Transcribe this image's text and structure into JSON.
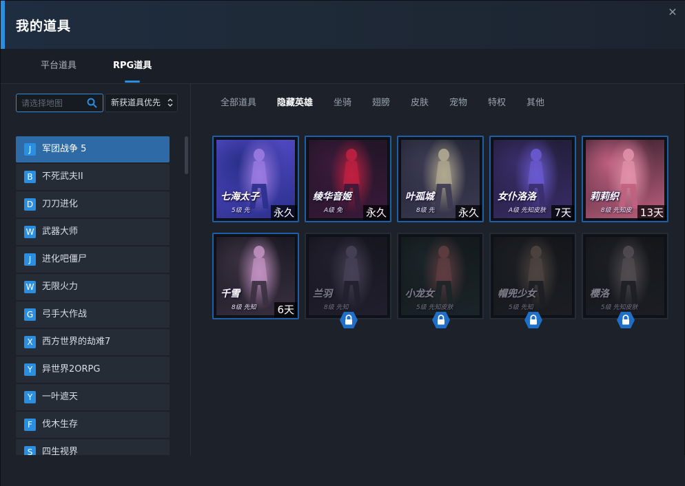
{
  "window": {
    "title": "我的道具"
  },
  "top_tabs": [
    {
      "label": "平台道具",
      "active": false
    },
    {
      "label": "RPG道具",
      "active": true
    }
  ],
  "sidebar": {
    "search_placeholder": "请选择地图",
    "sort_value": "新获道具优先",
    "games": [
      {
        "letter": "J",
        "name": "军团战争 5",
        "active": true
      },
      {
        "letter": "B",
        "name": "不死武夫II",
        "active": false
      },
      {
        "letter": "D",
        "name": "刀刀进化",
        "active": false
      },
      {
        "letter": "W",
        "name": "武器大师",
        "active": false
      },
      {
        "letter": "J",
        "name": "进化吧僵尸",
        "active": false
      },
      {
        "letter": "W",
        "name": "无限火力",
        "active": false
      },
      {
        "letter": "G",
        "name": "弓手大作战",
        "active": false
      },
      {
        "letter": "X",
        "name": "西方世界的劫难7",
        "active": false
      },
      {
        "letter": "Y",
        "name": "异世界2ORPG",
        "active": false
      },
      {
        "letter": "Y",
        "name": "一叶遮天",
        "active": false
      },
      {
        "letter": "F",
        "name": "伐木生存",
        "active": false
      },
      {
        "letter": "S",
        "name": "四生视界",
        "active": false
      }
    ]
  },
  "category_tabs": [
    {
      "label": "全部道具",
      "active": false
    },
    {
      "label": "隐藏英雄",
      "active": true
    },
    {
      "label": "坐骑",
      "active": false
    },
    {
      "label": "翅膀",
      "active": false
    },
    {
      "label": "皮肤",
      "active": false
    },
    {
      "label": "宠物",
      "active": false
    },
    {
      "label": "特权",
      "active": false
    },
    {
      "label": "其他",
      "active": false
    }
  ],
  "items": [
    {
      "caption": "七海太子",
      "sub": "5级 先",
      "duration": "永久",
      "locked": false,
      "palette": [
        "#5a4fd0",
        "#2a2f8a",
        "#9a7be0"
      ]
    },
    {
      "caption": "绫华音姬",
      "sub": "A级 免",
      "duration": "永久",
      "locked": false,
      "palette": [
        "#1a1420",
        "#3a1a3a",
        "#c02040"
      ]
    },
    {
      "caption": "叶孤城",
      "sub": "8级 先",
      "duration": "永久",
      "locked": false,
      "palette": [
        "#1e2230",
        "#3c3a52",
        "#b0a890"
      ]
    },
    {
      "caption": "女仆洛洛",
      "sub": "A级 先知皮肤",
      "duration": "7天",
      "locked": false,
      "palette": [
        "#1b1a2a",
        "#3a2d6a",
        "#6a5ad0"
      ]
    },
    {
      "caption": "莉莉织",
      "sub": "8级 先知皮",
      "duration": "13天",
      "locked": false,
      "palette": [
        "#2a1a24",
        "#c06080",
        "#e090a8"
      ]
    },
    {
      "caption": "千雪",
      "sub": "8级 先知",
      "duration": "6天",
      "locked": false,
      "palette": [
        "#10121a",
        "#3a3040",
        "#c090c0"
      ]
    },
    {
      "caption": "兰羽",
      "sub": "8级 先知",
      "duration": "",
      "locked": true,
      "palette": [
        "#15151c",
        "#3a2e48",
        "#8a7aa0"
      ]
    },
    {
      "caption": "小龙女",
      "sub": "5级 先知皮肤",
      "duration": "",
      "locked": true,
      "palette": [
        "#141a1a",
        "#2a3a3a",
        "#c07070"
      ]
    },
    {
      "caption": "帽兜少女",
      "sub": "5级 先知",
      "duration": "",
      "locked": true,
      "palette": [
        "#161616",
        "#2c2c30",
        "#9a8070"
      ]
    },
    {
      "caption": "樱洛",
      "sub": "5级 先知皮肤",
      "duration": "",
      "locked": true,
      "palette": [
        "#161616",
        "#2c2c30",
        "#a09090"
      ]
    }
  ],
  "colors": {
    "accent": "#2a8fe0",
    "active_item": "#2d6aa6",
    "card_border": "#1f5fa8",
    "lock_badge": "#1f6fc8"
  }
}
